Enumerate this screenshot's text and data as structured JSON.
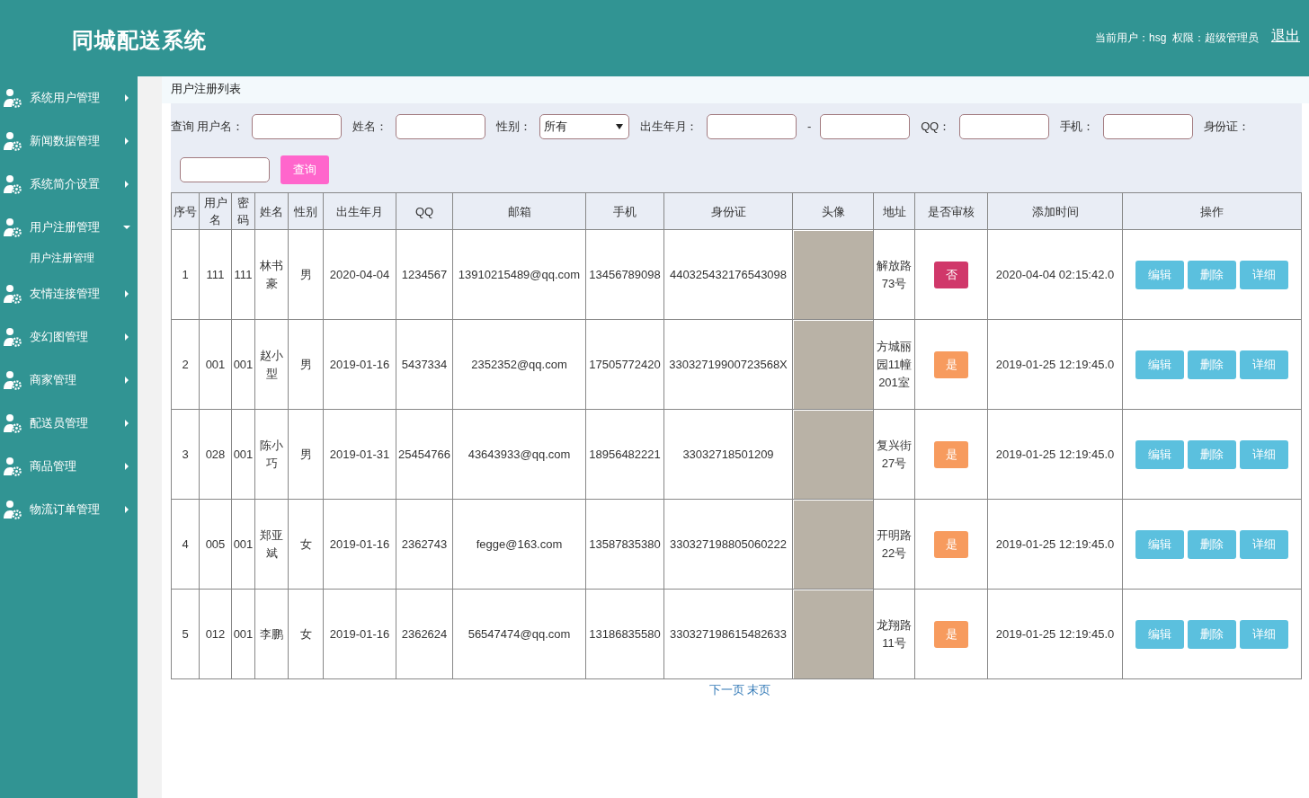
{
  "header": {
    "title": "同城配送系统",
    "user_info": "当前用户：hsg  权限：超级管理员",
    "logout": "退出"
  },
  "sidebar": {
    "items": [
      {
        "label": "系统用户管理",
        "expanded": false
      },
      {
        "label": "新闻数据管理",
        "expanded": false
      },
      {
        "label": "系统简介设置",
        "expanded": false
      },
      {
        "label": "用户注册管理",
        "expanded": true,
        "children": [
          {
            "label": "用户注册管理"
          }
        ]
      },
      {
        "label": "友情连接管理",
        "expanded": false
      },
      {
        "label": "变幻图管理",
        "expanded": false
      },
      {
        "label": "商家管理",
        "expanded": false
      },
      {
        "label": "配送员管理",
        "expanded": false
      },
      {
        "label": "商品管理",
        "expanded": false
      },
      {
        "label": "物流订单管理",
        "expanded": false
      }
    ]
  },
  "page_title": "用户注册列表",
  "filter": {
    "prefix": "查询",
    "fields": [
      {
        "kind": "text",
        "label": "用户名："
      },
      {
        "kind": "text",
        "label": "姓名："
      },
      {
        "kind": "select",
        "label": "性别：",
        "value": "所有"
      },
      {
        "kind": "range",
        "label": "出生年月：",
        "separator": "-"
      },
      {
        "kind": "text",
        "label": "QQ："
      },
      {
        "kind": "text",
        "label": "手机："
      },
      {
        "kind": "text",
        "label": "身份证："
      }
    ],
    "search_button": "查询"
  },
  "table": {
    "columns": [
      "序号",
      "用户名",
      "密码",
      "姓名",
      "性别",
      "出生年月",
      "QQ",
      "邮箱",
      "手机",
      "身份证",
      "头像",
      "地址",
      "是否审核",
      "添加时间",
      "操作"
    ],
    "rows": [
      {
        "cells": [
          "1",
          "111",
          "111",
          "林书豪",
          "男",
          "2020-04-04",
          "1234567",
          "13910215489@qq.com",
          "13456789098",
          "440325432176543098"
        ],
        "address": "解放路73号",
        "approval": "否",
        "approved": false,
        "added": "2020-04-04 02:15:42.0",
        "actions": [
          "编辑",
          "删除",
          "详细"
        ]
      },
      {
        "cells": [
          "2",
          "001",
          "001",
          "赵小型",
          "男",
          "2019-01-16",
          "5437334",
          "2352352@qq.com",
          "17505772420",
          "33032719900723568X"
        ],
        "address": "方城丽园11幢201室",
        "approval": "是",
        "approved": true,
        "added": "2019-01-25 12:19:45.0",
        "actions": [
          "编辑",
          "删除",
          "详细"
        ]
      },
      {
        "cells": [
          "3",
          "028",
          "001",
          "陈小巧",
          "男",
          "2019-01-31",
          "25454766",
          "43643933@qq.com",
          "18956482221",
          "33032718501209"
        ],
        "address": "复兴街27号",
        "approval": "是",
        "approved": true,
        "added": "2019-01-25 12:19:45.0",
        "actions": [
          "编辑",
          "删除",
          "详细"
        ]
      },
      {
        "cells": [
          "4",
          "005",
          "001",
          "郑亚斌",
          "女",
          "2019-01-16",
          "2362743",
          "fegge@163.com",
          "13587835380",
          "330327198805060222"
        ],
        "address": "开明路22号",
        "approval": "是",
        "approved": true,
        "added": "2019-01-25 12:19:45.0",
        "actions": [
          "编辑",
          "删除",
          "详细"
        ]
      },
      {
        "cells": [
          "5",
          "012",
          "001",
          "李鹏",
          "女",
          "2019-01-16",
          "2362624",
          "56547474@qq.com",
          "13186835580",
          "330327198615482633"
        ],
        "address": "龙翔路11号",
        "approval": "是",
        "approved": true,
        "added": "2019-01-25 12:19:45.0",
        "actions": [
          "编辑",
          "删除",
          "详细"
        ]
      }
    ]
  },
  "pagination": [
    "下一页",
    "末页"
  ]
}
